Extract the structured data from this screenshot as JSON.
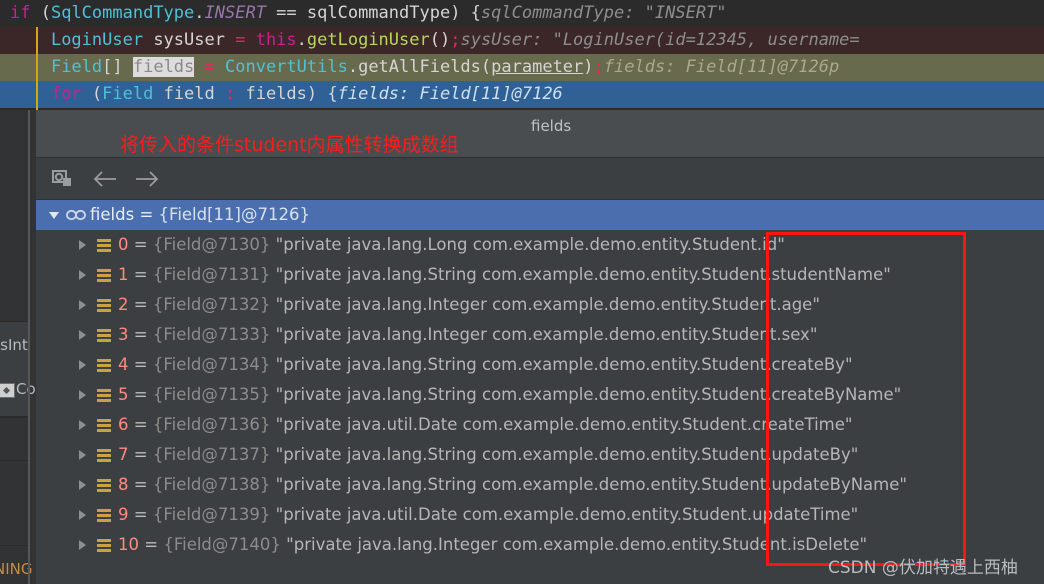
{
  "editor": {
    "lines": [
      {
        "id": "line-1",
        "tokens": "if (SqlCommandType.INSERT == sqlCommandType) {",
        "hint": "sqlCommandType: \"INSERT\""
      },
      {
        "id": "line-2",
        "tokens": "LoginUser sysUser = this.getLoginUser();",
        "hint": "sysUser: \"LoginUser(id=12345, username="
      },
      {
        "id": "line-3",
        "tokens": "Field[] fields = ConvertUtils.getAllFields(parameter);",
        "hint": "fields: Field[11]@7126",
        "hint_overflow": "p"
      },
      {
        "id": "line-4",
        "tokens": "for (Field field : fields) {",
        "hint": "fields: Field[11]@7126"
      }
    ],
    "keywords": {
      "if": "if",
      "for": "for",
      "this": "this"
    },
    "identifiers": {
      "sql_command_type": "SqlCommandType",
      "insert": "INSERT",
      "sql_command_type_var": "sqlCommandType",
      "login_user": "LoginUser",
      "sys_user": "sysUser",
      "get_login_user": "getLoginUser",
      "field": "Field",
      "fields": "fields",
      "convert_utils": "ConvertUtils",
      "get_all_fields": "getAllFields",
      "parameter": "parameter",
      "field_var": "field"
    }
  },
  "annotation": {
    "red_note": "将传入的条件student内属性转换成数组"
  },
  "tabstrip": {
    "tab_label": "fields"
  },
  "toolbar": {
    "buttons": [
      {
        "id": "evaluate-expression",
        "icon": "evaluate-icon",
        "label": "Evaluate Expression"
      },
      {
        "id": "back",
        "icon": "arrow-left-icon",
        "label": "Back"
      },
      {
        "id": "forward",
        "icon": "arrow-right-icon",
        "label": "Forward"
      }
    ]
  },
  "tree": {
    "root": {
      "expander": "▼",
      "icon": "array-icon",
      "name": "fields",
      "equals": "=",
      "value": "{Field[11]@7126}",
      "selected": true
    },
    "rows": [
      {
        "index": "0",
        "equals": "=",
        "ref": "{Field@7130}",
        "value": "\"private java.lang.Long com.example.demo.entity.Student.id\""
      },
      {
        "index": "1",
        "equals": "=",
        "ref": "{Field@7131}",
        "value": "\"private java.lang.String com.example.demo.entity.Student.studentName\""
      },
      {
        "index": "2",
        "equals": "=",
        "ref": "{Field@7132}",
        "value": "\"private java.lang.Integer com.example.demo.entity.Student.age\""
      },
      {
        "index": "3",
        "equals": "=",
        "ref": "{Field@7133}",
        "value": "\"private java.lang.Integer com.example.demo.entity.Student.sex\""
      },
      {
        "index": "4",
        "equals": "=",
        "ref": "{Field@7134}",
        "value": "\"private java.lang.String com.example.demo.entity.Student.createBy\""
      },
      {
        "index": "5",
        "equals": "=",
        "ref": "{Field@7135}",
        "value": "\"private java.lang.String com.example.demo.entity.Student.createByName\""
      },
      {
        "index": "6",
        "equals": "=",
        "ref": "{Field@7136}",
        "value": "\"private java.util.Date com.example.demo.entity.Student.createTime\""
      },
      {
        "index": "7",
        "equals": "=",
        "ref": "{Field@7137}",
        "value": "\"private java.lang.String com.example.demo.entity.Student.updateBy\""
      },
      {
        "index": "8",
        "equals": "=",
        "ref": "{Field@7138}",
        "value": "\"private java.lang.String com.example.demo.entity.Student.updateByName\""
      },
      {
        "index": "9",
        "equals": "=",
        "ref": "{Field@7139}",
        "value": "\"private java.util.Date com.example.demo.entity.Student.updateTime\""
      },
      {
        "index": "10",
        "equals": "=",
        "ref": "{Field@7140}",
        "value": "\"private java.lang.Integer com.example.demo.entity.Student.isDelete\""
      }
    ]
  },
  "left_panel": {
    "clipped_label_1": "isInt",
    "clipped_label_2": "Co",
    "clipped_label_3": "NING"
  },
  "watermark": {
    "text": "CSDN @伏加特遇上西柚"
  },
  "colors": {
    "editor_bg": "#2b2b2b",
    "panel_bg": "#3c3f41",
    "selection_blue": "#4b6eaf",
    "line_highlight_blue": "#2f6096",
    "annotation_red": "#ff1414",
    "index_salmon": "#ff8a80",
    "object_icon_gold": "#c9a243"
  }
}
